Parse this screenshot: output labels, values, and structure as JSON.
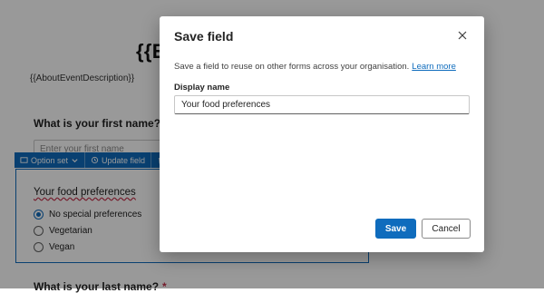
{
  "background_form": {
    "event_title": "{{Ev",
    "event_description": "{{AboutEventDescription}}",
    "first_name_question": "What is your first name?",
    "first_name_placeholder": "Enter your first name",
    "last_name_question": "What is your last name?",
    "required_marker": "*",
    "toolbar": {
      "option_set_label": "Option set",
      "update_field_label": "Update field",
      "delete_icon": "trash-icon"
    },
    "selected_field": {
      "title": "Your food preferences",
      "options": [
        {
          "label": "No special preferences",
          "checked": true
        },
        {
          "label": "Vegetarian",
          "checked": false
        },
        {
          "label": "Vegan",
          "checked": false
        }
      ]
    }
  },
  "dialog": {
    "title": "Save field",
    "close_icon": "close-icon",
    "description": "Save a field to reuse on other forms across your organisation.",
    "learn_more": "Learn more",
    "display_name_label": "Display name",
    "display_name_value": "Your food preferences",
    "save_label": "Save",
    "cancel_label": "Cancel"
  },
  "colors": {
    "accent": "#0f6cbd",
    "overlay": "rgba(0,0,0,0.40)",
    "required": "#c4314b"
  }
}
